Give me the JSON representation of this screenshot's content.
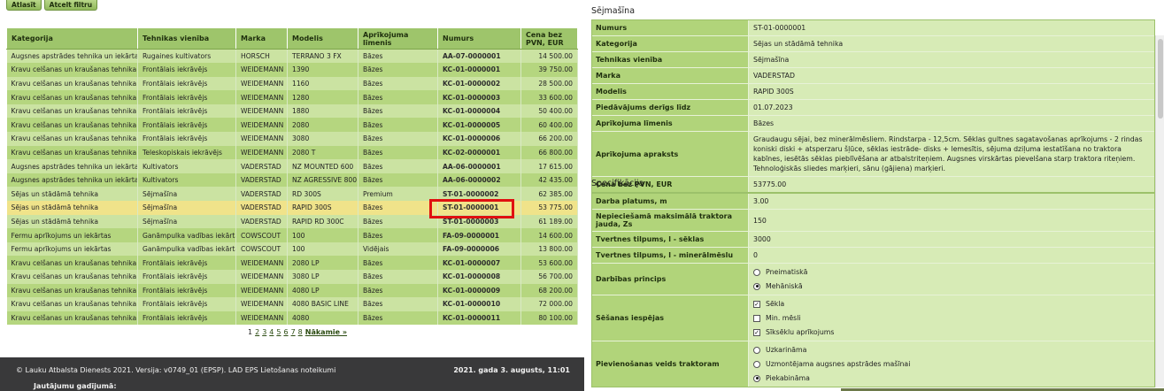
{
  "buttons": {
    "search": "Atlasīt",
    "clear": "Atcelt filtru"
  },
  "table": {
    "columns": [
      "Kategorija",
      "Tehnikas vienība",
      "Marka",
      "Modelis",
      "Aprīkojuma līmenis",
      "Numurs",
      "Cena bez PVN, EUR"
    ],
    "rows": [
      [
        "Augsnes apstrādes tehnika un iekārtas",
        "Rugaines kultivators",
        "HORSCH",
        "TERRANO 3 FX",
        "Bāzes",
        "AA-07-0000001",
        "14 500.00"
      ],
      [
        "Kravu celšanas un kraušanas tehnika",
        "Frontālais iekrāvējs",
        "WEIDEMANN",
        "1390",
        "Bāzes",
        "KC-01-0000001",
        "39 750.00"
      ],
      [
        "Kravu celšanas un kraušanas tehnika",
        "Frontālais iekrāvējs",
        "WEIDEMANN",
        "1160",
        "Bāzes",
        "KC-01-0000002",
        "28 500.00"
      ],
      [
        "Kravu celšanas un kraušanas tehnika",
        "Frontālais iekrāvējs",
        "WEIDEMANN",
        "1280",
        "Bāzes",
        "KC-01-0000003",
        "33 600.00"
      ],
      [
        "Kravu celšanas un kraušanas tehnika",
        "Frontālais iekrāvējs",
        "WEIDEMANN",
        "1880",
        "Bāzes",
        "KC-01-0000004",
        "50 400.00"
      ],
      [
        "Kravu celšanas un kraušanas tehnika",
        "Frontālais iekrāvējs",
        "WEIDEMANN",
        "2080",
        "Bāzes",
        "KC-01-0000005",
        "60 400.00"
      ],
      [
        "Kravu celšanas un kraušanas tehnika",
        "Frontālais iekrāvējs",
        "WEIDEMANN",
        "3080",
        "Bāzes",
        "KC-01-0000006",
        "66 200.00"
      ],
      [
        "Kravu celšanas un kraušanas tehnika",
        "Teleskopiskais iekrāvējs",
        "WEIDEMANN",
        "2080 T",
        "Bāzes",
        "KC-02-0000001",
        "66 800.00"
      ],
      [
        "Augsnes apstrādes tehnika un iekārtas",
        "Kultivators",
        "VADERSTAD",
        "NZ MOUNTED 600",
        "Bāzes",
        "AA-06-0000001",
        "17 615.00"
      ],
      [
        "Augsnes apstrādes tehnika un iekārtas",
        "Kultivators",
        "VADERSTAD",
        "NZ AGRESSIVE 800",
        "Bāzes",
        "AA-06-0000002",
        "42 435.00"
      ],
      [
        "Sējas un stādāmā tehnika",
        "Sējmašīna",
        "VADERSTAD",
        "RD 300S",
        "Premium",
        "ST-01-0000002",
        "62 385.00"
      ],
      [
        "Sējas un stādāmā tehnika",
        "Sējmašīna",
        "VADERSTAD",
        "RAPID 300S",
        "Bāzes",
        "ST-01-0000001",
        "53 775.00"
      ],
      [
        "Sējas un stādāmā tehnika",
        "Sējmašīna",
        "VADERSTAD",
        "RAPID RD 300C",
        "Bāzes",
        "ST-01-0000003",
        "61 189.00"
      ],
      [
        "Fermu aprīkojums un iekārtas",
        "Ganāmpulka vadības iekārta",
        "COWSCOUT",
        "100",
        "Bāzes",
        "FA-09-0000001",
        "14 600.00"
      ],
      [
        "Fermu aprīkojums un iekārtas",
        "Ganāmpulka vadības iekārta",
        "COWSCOUT",
        "100",
        "Vidējais",
        "FA-09-0000006",
        "13 800.00"
      ],
      [
        "Kravu celšanas un kraušanas tehnika",
        "Frontālais iekrāvējs",
        "WEIDEMANN",
        "2080 LP",
        "Bāzes",
        "KC-01-0000007",
        "53 600.00"
      ],
      [
        "Kravu celšanas un kraušanas tehnika",
        "Frontālais iekrāvējs",
        "WEIDEMANN",
        "3080 LP",
        "Bāzes",
        "KC-01-0000008",
        "56 700.00"
      ],
      [
        "Kravu celšanas un kraušanas tehnika",
        "Frontālais iekrāvējs",
        "WEIDEMANN",
        "4080 LP",
        "Bāzes",
        "KC-01-0000009",
        "68 200.00"
      ],
      [
        "Kravu celšanas un kraušanas tehnika",
        "Frontālais iekrāvējs",
        "WEIDEMANN",
        "4080 BASIC LINE",
        "Bāzes",
        "KC-01-0000010",
        "72 000.00"
      ],
      [
        "Kravu celšanas un kraušanas tehnika",
        "Frontālais iekrāvējs",
        "WEIDEMANN",
        "4080",
        "Bāzes",
        "KC-01-0000011",
        "80 100.00"
      ]
    ],
    "selected_row": 11
  },
  "pager": {
    "pages": [
      "1",
      "2",
      "3",
      "4",
      "5",
      "6",
      "7",
      "8"
    ],
    "current": "1",
    "next": "Nākamie »"
  },
  "footer": {
    "copyright": "© Lauku Atbalsta Dienests 2021. Versija: v0749_01 (EPSP). LAD EPS Lietošanas noteikumi",
    "date": "2021. gada 3. augusts, 11:01",
    "questions": "Jautājumu gadījumā:"
  },
  "detail": {
    "title": "Sējmašīna",
    "rows": [
      {
        "label": "Numurs",
        "value": "ST-01-0000001"
      },
      {
        "label": "Kategorija",
        "value": "Sējas un stādāmā tehnika"
      },
      {
        "label": "Tehnikas vienība",
        "value": "Sējmašīna"
      },
      {
        "label": "Marka",
        "value": "VADERSTAD"
      },
      {
        "label": "Modelis",
        "value": "RAPID 300S"
      },
      {
        "label": "Piedāvājums derīgs līdz",
        "value": "01.07.2023"
      },
      {
        "label": "Aprīkojuma līmenis",
        "value": "Bāzes"
      },
      {
        "label": "Aprīkojuma apraksts",
        "value": "Graudaugu sējai, bez minerālmēsliem. Rindstarpa - 12,5cm. Sēklas gultnes sagatavošanas aprīkojums - 2 rindas koniski diski + atsperzaru šļūce, sēklas iestrāde- disks + lemesītis, sējuma dziļuma iestatīšana no traktora kabīnes, iesētās sēklas pieblīvēšana ar atbalstriteņiem. Augsnes virskārtas pievelšana starp traktora riteņiem. Tehnoloģiskās sliedes marķieri, sānu (gājiena) marķieri."
      },
      {
        "label": "Cena bez PVN, EUR",
        "value": "53775.00"
      }
    ]
  },
  "spec": {
    "title": "Specifikācija",
    "rows": [
      {
        "label": "Darba platums, m",
        "value": "3.00"
      },
      {
        "label": "Nepieciešamā maksimālā traktora jauda, Zs",
        "value": "150"
      },
      {
        "label": "Tvertnes tilpums, l - sēklas",
        "value": "3000"
      },
      {
        "label": "Tvertnes tilpums, l - minerālmēslu",
        "value": "0"
      }
    ],
    "principle": {
      "label": "Darbības princips",
      "options": [
        {
          "text": "Pneimatiskā",
          "checked": false
        },
        {
          "text": "Mehāniskā",
          "checked": true
        }
      ]
    },
    "seeding": {
      "label": "Sēšanas iespējas",
      "options": [
        {
          "text": "Sēkla",
          "checked": true
        },
        {
          "text": "Min. mēsli",
          "checked": false
        },
        {
          "text": "Sīksēklu aprīkojums",
          "checked": true
        }
      ]
    },
    "hitch": {
      "label": "Pievienošanas veids traktoram",
      "options": [
        {
          "text": "Uzkarināma",
          "checked": false
        },
        {
          "text": "Uzmontējama augsnes apstrādes mašīnai",
          "checked": false
        },
        {
          "text": "Piekabināma",
          "checked": true
        }
      ]
    }
  }
}
